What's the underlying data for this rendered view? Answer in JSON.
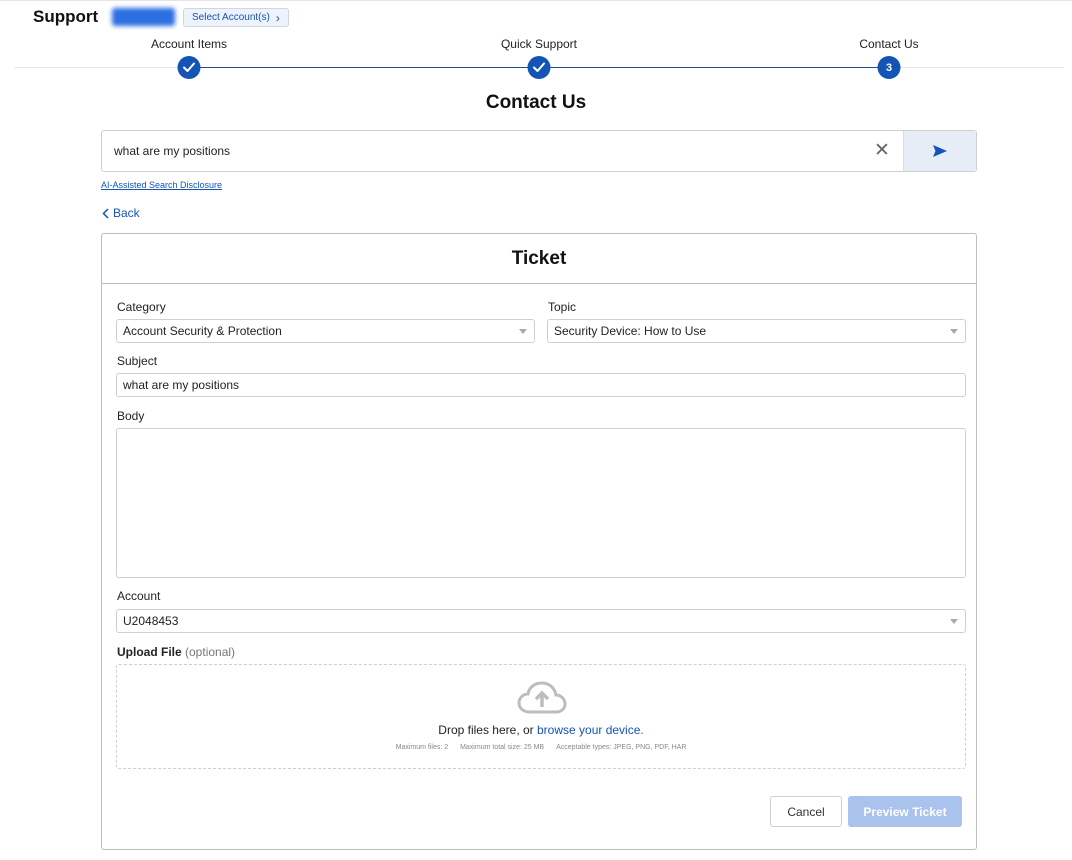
{
  "header": {
    "title": "Support",
    "select_accounts_label": "Select Account(s)"
  },
  "stepper": {
    "steps": [
      {
        "label": "Account Items",
        "status": "complete"
      },
      {
        "label": "Quick Support",
        "status": "complete"
      },
      {
        "label": "Contact Us",
        "status": "current",
        "number": "3"
      }
    ]
  },
  "page": {
    "heading": "Contact Us"
  },
  "search": {
    "value": "what are my positions",
    "disclosure_link": "AI-Assisted Search Disclosure"
  },
  "back_label": "Back",
  "ticket": {
    "title": "Ticket",
    "category": {
      "label": "Category",
      "value": "Account Security & Protection"
    },
    "topic": {
      "label": "Topic",
      "value": "Security Device: How to Use"
    },
    "subject": {
      "label": "Subject",
      "value": "what are my positions"
    },
    "body": {
      "label": "Body",
      "value": ""
    },
    "account": {
      "label": "Account",
      "value": "U2048453"
    },
    "upload": {
      "label": "Upload File",
      "optional": "(optional)",
      "drop_text": "Drop files here, or",
      "browse_link": "browse your device.",
      "max_files": "Maximum files: 2",
      "max_size": "Maximum total size: 25 MB",
      "types": "Acceptable types: JPEG, PNG, PDF, HAR"
    },
    "cancel_label": "Cancel",
    "preview_label": "Preview Ticket"
  },
  "colors": {
    "accent": "#1354b5",
    "disabled_button": "#a9c3ec"
  }
}
